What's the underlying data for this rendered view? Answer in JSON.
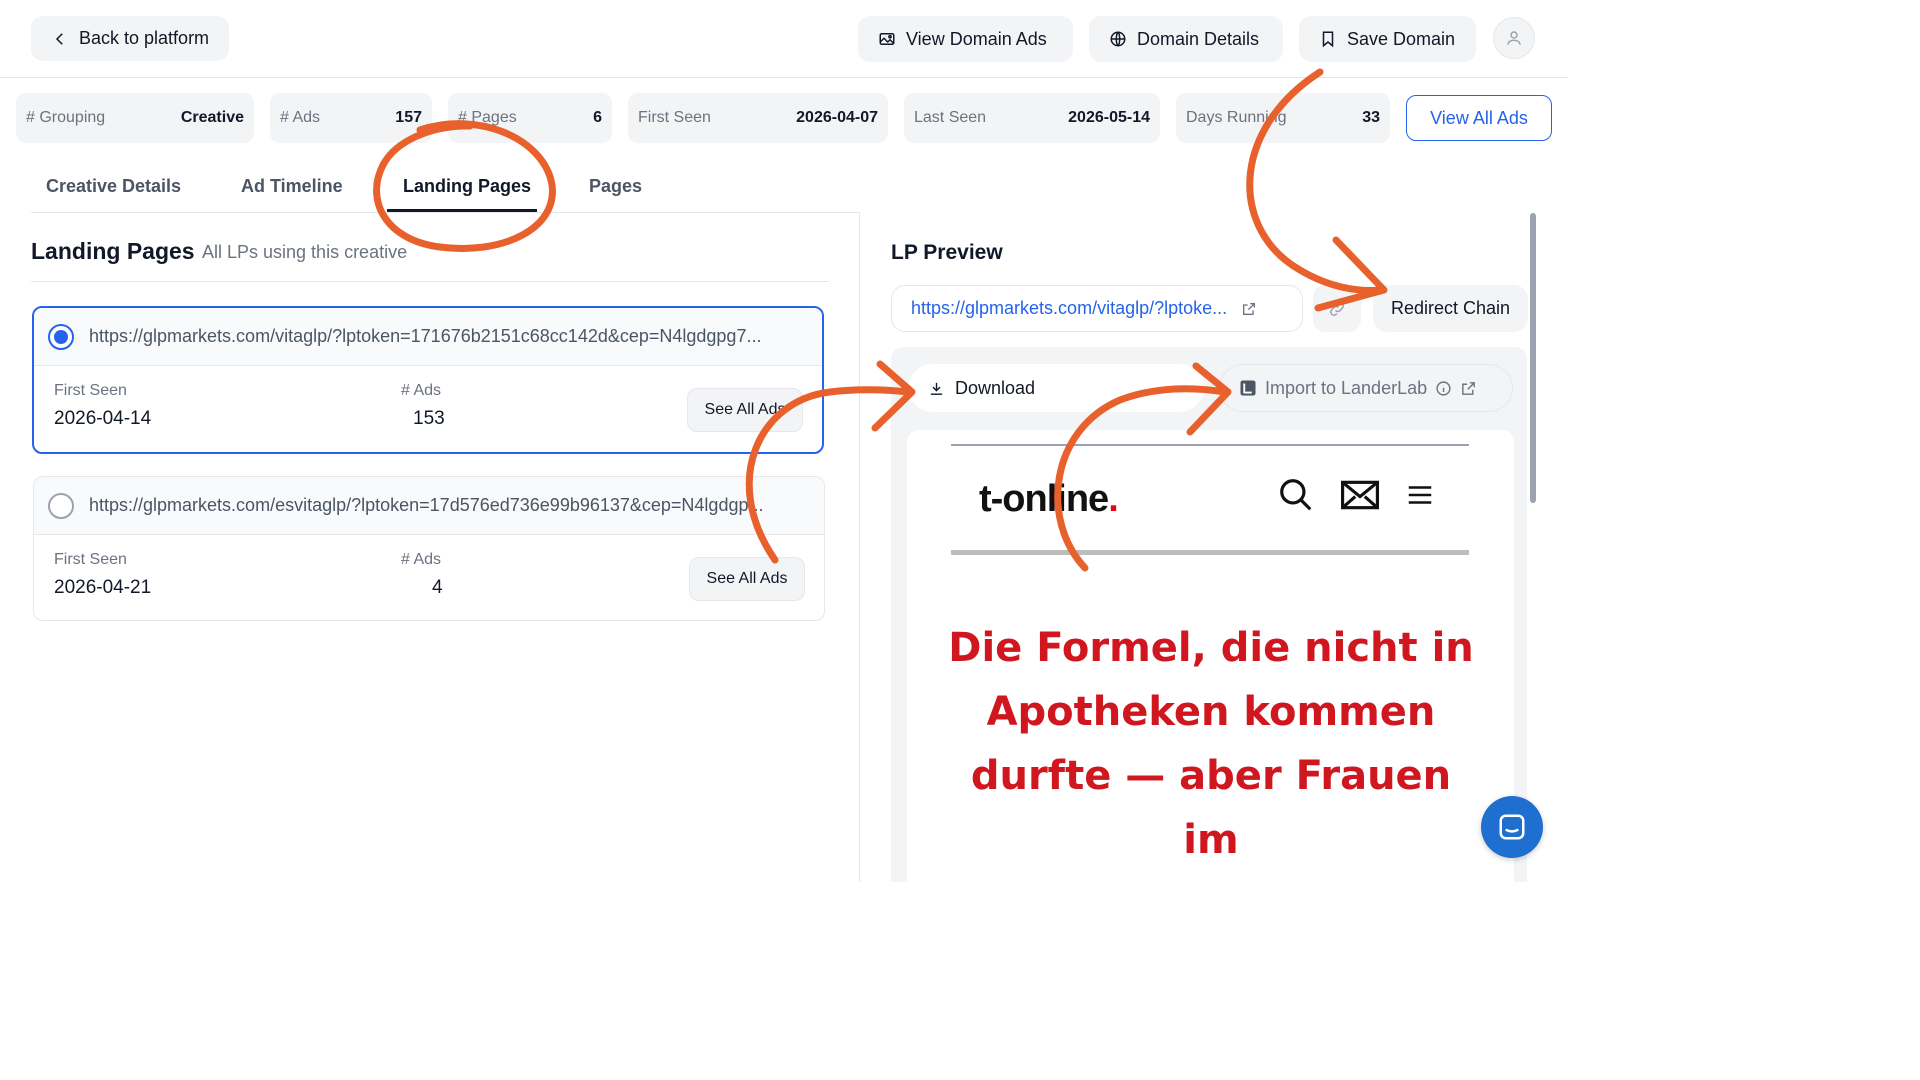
{
  "header": {
    "back_label": "Back to platform",
    "view_domain_ads": "View Domain Ads",
    "domain_details": "Domain Details",
    "save_domain": "Save Domain"
  },
  "stats": {
    "grouping_label": "# Grouping",
    "grouping_value": "Creative",
    "ads_label": "# Ads",
    "ads_value": "157",
    "pages_label": "# Pages",
    "pages_value": "6",
    "first_seen_label": "First Seen",
    "first_seen_value": "2026-04-07",
    "last_seen_label": "Last Seen",
    "last_seen_value": "2026-05-14",
    "days_running_label": "Days Running",
    "days_running_value": "33",
    "view_all_ads": "View All Ads"
  },
  "tabs": [
    {
      "label": "Creative Details"
    },
    {
      "label": "Ad Timeline"
    },
    {
      "label": "Landing Pages",
      "active": true
    },
    {
      "label": "Pages"
    }
  ],
  "landing_pages": {
    "title": "Landing Pages",
    "subtitle": "All LPs using this creative",
    "items": [
      {
        "url": "https://glpmarkets.com/vitaglp/?lptoken=171676b2151c68cc142d&cep=N4lgdgpg7...",
        "first_seen_label": "First Seen",
        "first_seen": "2026-04-14",
        "ads_label": "# Ads",
        "ads": "153",
        "button": "See All Ads",
        "selected": true
      },
      {
        "url": "https://glpmarkets.com/esvitaglp/?lptoken=17d576ed736e99b96137&cep=N4lgdgp...",
        "first_seen_label": "First Seen",
        "first_seen": "2026-04-21",
        "ads_label": "# Ads",
        "ads": "4",
        "button": "See All Ads",
        "selected": false
      }
    ]
  },
  "preview": {
    "title": "LP Preview",
    "url": "https://glpmarkets.com/vitaglp/?lptoke...",
    "redirect_chain": "Redirect Chain",
    "download": "Download",
    "import": "Import to LanderLab",
    "site_logo": "t-online",
    "site_logo_dot": ".",
    "headline": "Die Formel, die nicht in Apotheken kommen durfte — aber Frauen im"
  },
  "icons": [
    "chevron-left-icon",
    "image-icon",
    "globe-icon",
    "bookmark-icon",
    "user-icon",
    "external-link-icon",
    "link-icon",
    "download-icon",
    "landerlab-icon",
    "info-icon",
    "search-icon",
    "mail-icon",
    "menu-icon",
    "chat-icon"
  ],
  "colors": {
    "accent": "#2563eb",
    "annotation": "#e8602c",
    "headline": "#d0161f"
  }
}
